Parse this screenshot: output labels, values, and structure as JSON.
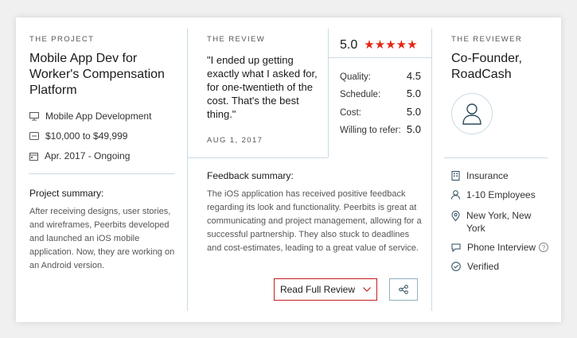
{
  "project": {
    "section_label": "THE PROJECT",
    "title": "Mobile App Dev for Worker's Compensation Platform",
    "service": "Mobile App Development",
    "budget": "$10,000 to $49,999",
    "dates": "Apr. 2017 - Ongoing",
    "summary_title": "Project summary:",
    "summary": "After receiving designs, user stories, and wireframes, Peerbits developed and launched an iOS mobile application. Now, they are working on an Android version."
  },
  "review": {
    "section_label": "THE REVIEW",
    "quote": "\"I ended up getting exactly what I asked for, for one-twentieth of the cost. That's the best thing.\"",
    "date": "AUG 1, 2017",
    "overall": "5.0",
    "stars": 5,
    "scores": [
      {
        "label": "Quality:",
        "value": "4.5"
      },
      {
        "label": "Schedule:",
        "value": "5.0"
      },
      {
        "label": "Cost:",
        "value": "5.0"
      },
      {
        "label": "Willing to refer:",
        "value": "5.0"
      }
    ],
    "feedback_title": "Feedback summary:",
    "feedback": "The iOS application has received positive feedback regarding its look and functionality. Peerbits is great at communicating and project management, allowing for a successful partnership. They also stuck to deadlines and cost-estimates, leading to a great value of service.",
    "read_button": "Read Full Review"
  },
  "reviewer": {
    "section_label": "THE REVIEWER",
    "title": "Co-Founder, RoadCash",
    "industry": "Insurance",
    "size": "1-10 Employees",
    "location": "New York, New York",
    "interview": "Phone Interview",
    "help": "?",
    "verified": "Verified"
  },
  "colors": {
    "accent_red": "#e62415",
    "divider": "#c9dbe4"
  }
}
